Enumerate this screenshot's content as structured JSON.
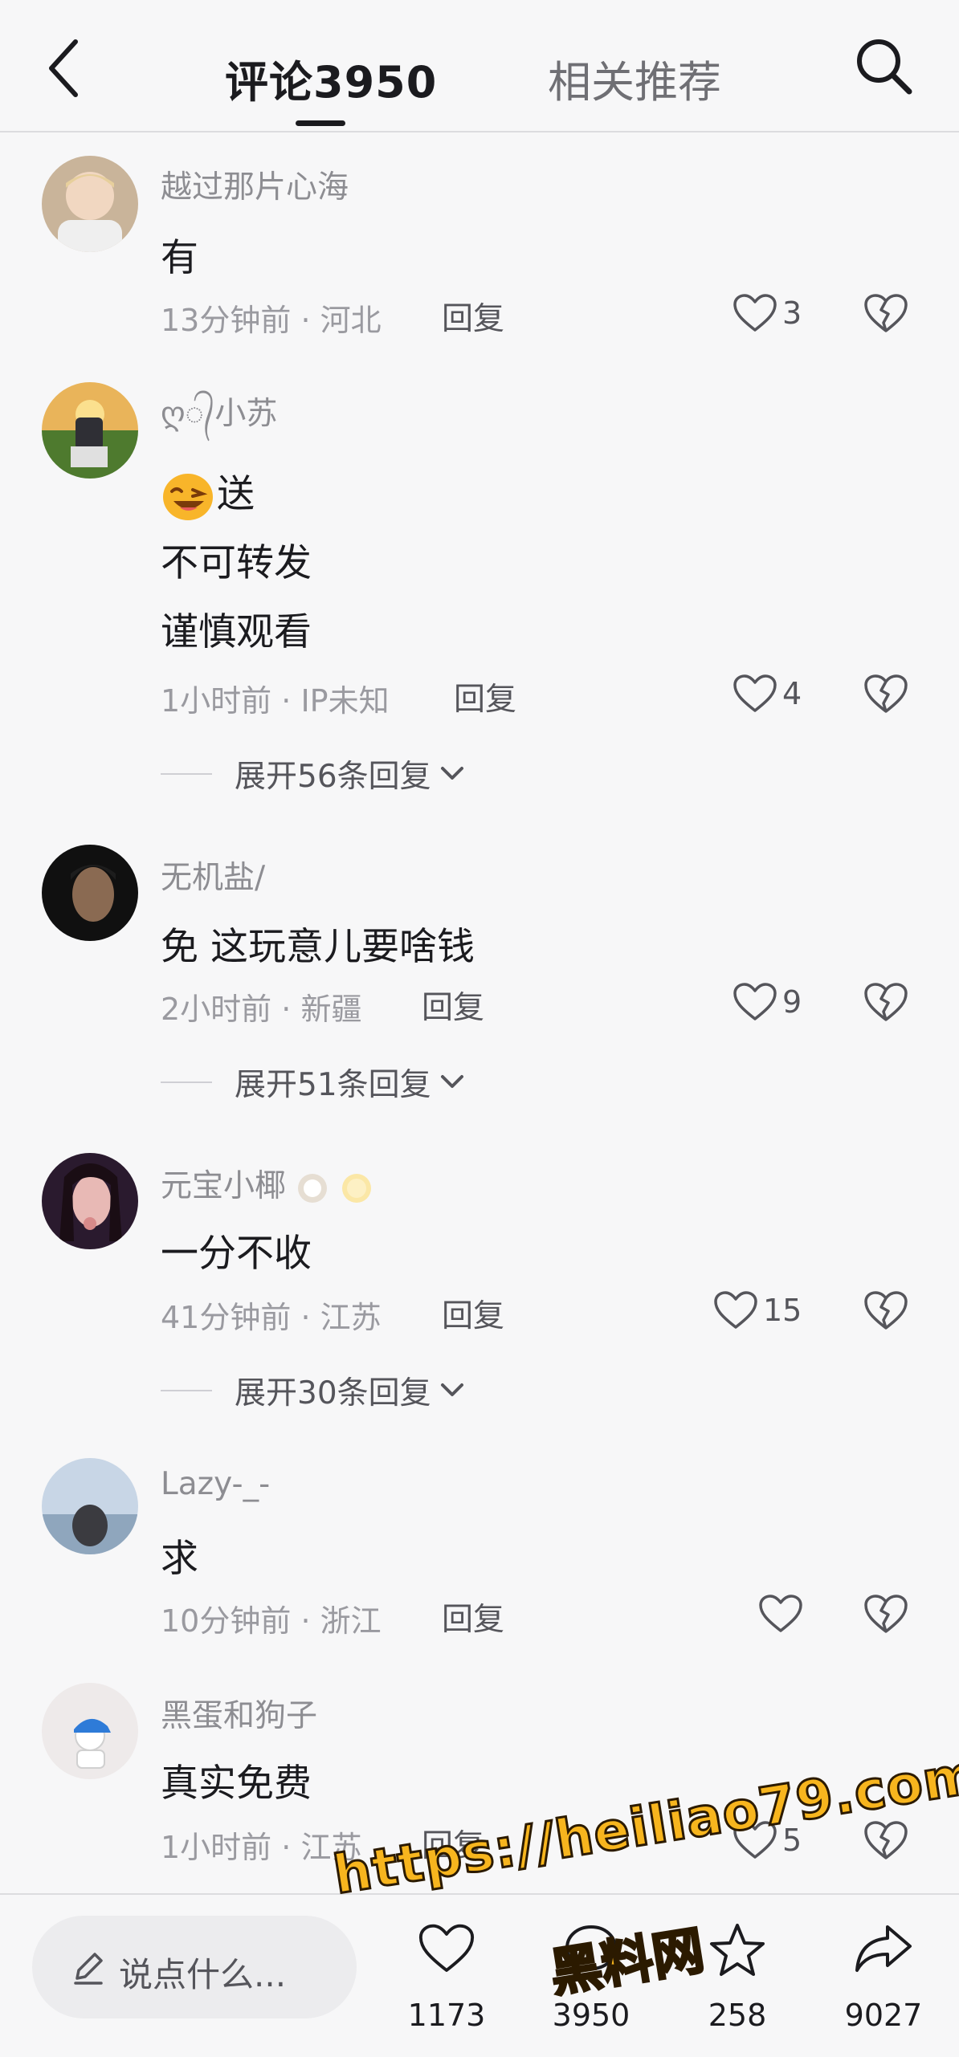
{
  "header": {
    "tab_comments": "评论3950",
    "tab_related": "相关推荐"
  },
  "comments": [
    {
      "username": "越过那片心海",
      "lines": [
        "有"
      ],
      "time": "13分钟前",
      "location": "河北",
      "reply": "回复",
      "likes": "3"
    },
    {
      "username": "ღ᭄小苏",
      "lines": [
        "送",
        "不可转发",
        "谨慎观看"
      ],
      "emoji": "laughing-face-emoji",
      "time": "1小时前",
      "location": "IP未知",
      "reply": "回复",
      "likes": "4",
      "expand": "展开56条回复"
    },
    {
      "username": "无机盐/",
      "lines": [
        "免 这玩意儿要啥钱"
      ],
      "time": "2小时前",
      "location": "新疆",
      "reply": "回复",
      "likes": "9",
      "expand": "展开51条回复"
    },
    {
      "username": "元宝小椰",
      "lines": [
        "一分不收"
      ],
      "time": "41分钟前",
      "location": "江苏",
      "reply": "回复",
      "likes": "15",
      "expand": "展开30条回复"
    },
    {
      "username": "Lazy-_-",
      "lines": [
        "求"
      ],
      "time": "10分钟前",
      "location": "浙江",
      "reply": "回复",
      "likes": ""
    },
    {
      "username": "黑蛋和狗子",
      "lines": [
        "真实免费"
      ],
      "time": "1小时前",
      "location": "江苏",
      "reply": "回复",
      "likes": "5"
    }
  ],
  "bottom_bar": {
    "input_placeholder": "说点什么...",
    "like_count": "1173",
    "comment_count": "3950",
    "favorite_count": "258",
    "share_count": "9027"
  },
  "watermark": {
    "url": "https://heiliao79.com",
    "name": "黑料网"
  },
  "colors": {
    "background": "#f7f7f8",
    "text_primary": "#1b1b1f",
    "text_secondary": "#8d8d92",
    "watermark": "#f7b51e"
  }
}
